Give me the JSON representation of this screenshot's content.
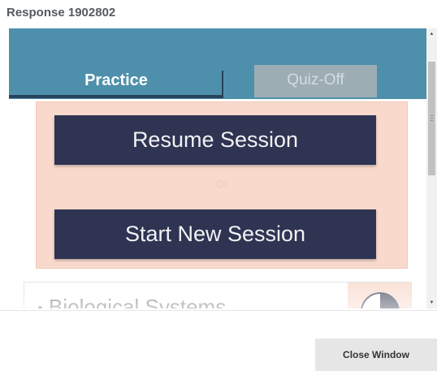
{
  "dialog": {
    "title": "Response 1902802"
  },
  "tabs": [
    {
      "label": "Practice",
      "active": true
    },
    {
      "label": "Quiz-Off",
      "active": false
    }
  ],
  "session": {
    "resume_label": "Resume Session",
    "separator": "or",
    "new_label": "Start New Session"
  },
  "topic": {
    "title": "Biological Systems",
    "progress_icon": "pie-chart-icon"
  },
  "footer": {
    "close_label": "Close Window"
  },
  "colors": {
    "header_band": "#4e90ab",
    "active_tab_underline": "#27435a",
    "inactive_tab": "#9dadb4",
    "session_panel": "#f8d9cc",
    "session_button": "#2e3452",
    "close_button": "#e6e6e6"
  }
}
